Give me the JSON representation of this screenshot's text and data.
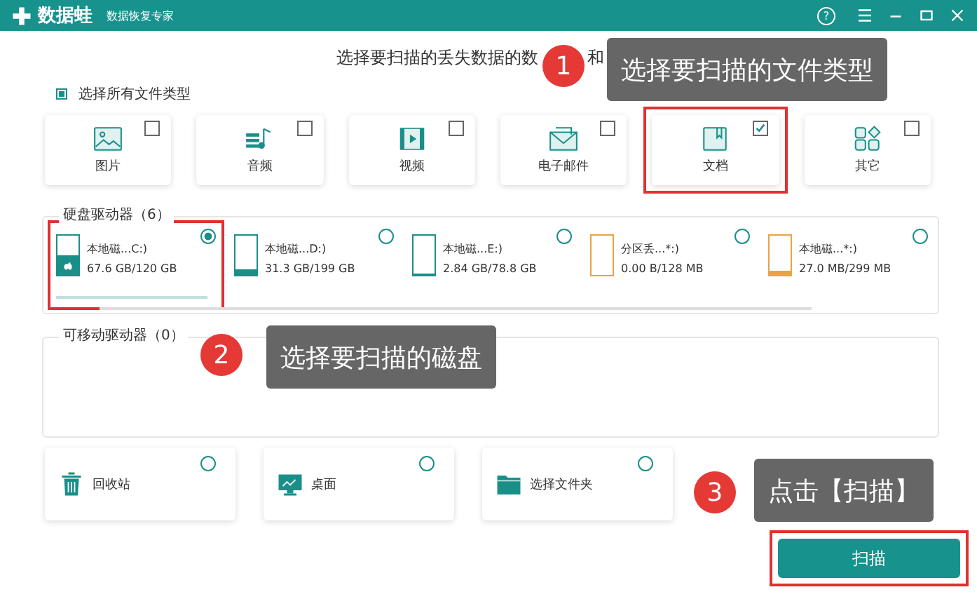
{
  "window": {
    "app_name": "数据蛙",
    "subtitle": "数据恢复专家",
    "help": "?"
  },
  "heading": {
    "text": "选择要扫描的丢失数据的数",
    "fragment": "和"
  },
  "select_all": {
    "label": "选择所有文件类型",
    "checked": true
  },
  "file_types": [
    {
      "kind": "image",
      "label": "图片",
      "checked": false,
      "highlighted": false
    },
    {
      "kind": "audio",
      "label": "音频",
      "checked": false,
      "highlighted": false
    },
    {
      "kind": "video",
      "label": "视频",
      "checked": false,
      "highlighted": false
    },
    {
      "kind": "email",
      "label": "电子邮件",
      "checked": false,
      "highlighted": false
    },
    {
      "kind": "document",
      "label": "文档",
      "checked": true,
      "highlighted": true
    },
    {
      "kind": "other",
      "label": "其它",
      "checked": false,
      "highlighted": false
    }
  ],
  "hard_drives": {
    "title": "硬盘驱动器（6）",
    "items": [
      {
        "kind": "system",
        "name": "本地磁...C:)",
        "size": "67.6 GB/120 GB",
        "level": 0.5,
        "color": "#1a8f8a",
        "selected": true,
        "highlighted": true
      },
      {
        "kind": "disk",
        "name": "本地磁...D:)",
        "size": "31.3 GB/199 GB",
        "level": 0.16,
        "color": "#1a8f8a",
        "selected": false,
        "highlighted": false
      },
      {
        "kind": "disk",
        "name": "本地磁...E:)",
        "size": "2.84 GB/78.8 GB",
        "level": 0.04,
        "color": "#1a8f8a",
        "selected": false,
        "highlighted": false
      },
      {
        "kind": "disk",
        "name": "分区丢...*:)",
        "size": "0.00  B/128 MB",
        "level": 0,
        "color": "#e8a444",
        "selected": false,
        "highlighted": false
      },
      {
        "kind": "disk",
        "name": "本地磁...*:)",
        "size": "27.0 MB/299 MB",
        "level": 0.1,
        "color": "#e8a444",
        "selected": false,
        "highlighted": false
      }
    ]
  },
  "removable_drives": {
    "title": "可移动驱动器（0）"
  },
  "locations": [
    {
      "kind": "recycle",
      "label": "回收站",
      "selected": false
    },
    {
      "kind": "desktop",
      "label": "桌面",
      "selected": false
    },
    {
      "kind": "folder",
      "label": "选择文件夹",
      "selected": false
    }
  ],
  "scan_button": {
    "label": "扫描",
    "highlighted": true
  },
  "callouts": [
    {
      "number": "1",
      "text": "选择要扫描的文件类型"
    },
    {
      "number": "2",
      "text": "选择要扫描的磁盘"
    },
    {
      "number": "3",
      "text": "点击【扫描】"
    }
  ]
}
